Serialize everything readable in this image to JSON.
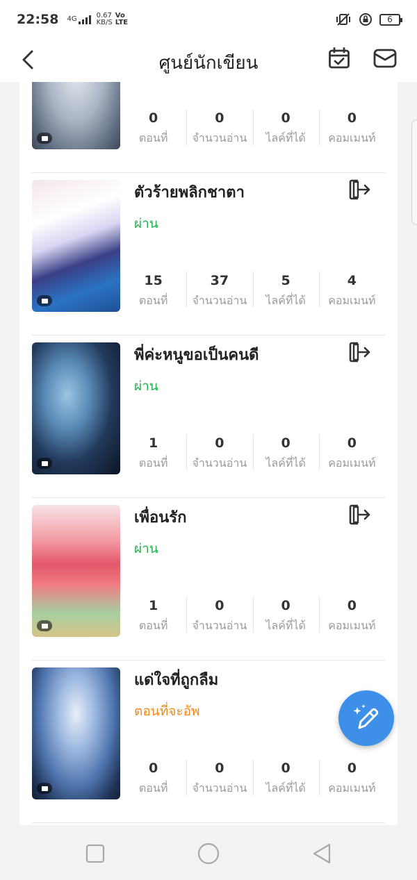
{
  "status_bar": {
    "time": "22:58",
    "network_top": "4G",
    "speed": "0.67",
    "speed_unit": "KB/S",
    "volte": "Vo",
    "lte": "LTE",
    "battery": "6"
  },
  "header": {
    "title": "ศูนย์นักเขียน",
    "back_icon": "chevron-left-icon",
    "calendar_icon": "calendar-check-icon",
    "mail_icon": "mail-icon"
  },
  "stat_labels": {
    "episodes": "ตอนที่",
    "reads": "จำนวนอ่าน",
    "likes": "ไลค์ที่ได้",
    "comments": "คอมเมนท์"
  },
  "books": [
    {
      "title": "",
      "status": "",
      "stats": {
        "episodes": "0",
        "reads": "0",
        "likes": "0",
        "comments": "0"
      }
    },
    {
      "title": "ตัวร้ายพลิกชาตา",
      "status": "ผ่าน",
      "stats": {
        "episodes": "15",
        "reads": "37",
        "likes": "5",
        "comments": "4"
      }
    },
    {
      "title": "พี่ค่ะหนูขอเป็นคนดี",
      "status": "ผ่าน",
      "stats": {
        "episodes": "1",
        "reads": "0",
        "likes": "0",
        "comments": "0"
      }
    },
    {
      "title": "เพื่อนรัก",
      "status": "ผ่าน",
      "stats": {
        "episodes": "1",
        "reads": "0",
        "likes": "0",
        "comments": "0"
      }
    },
    {
      "title": "แด่ใจที่ถูกลืม",
      "status": "ตอนที่จะอัพ",
      "stats": {
        "episodes": "0",
        "reads": "0",
        "likes": "0",
        "comments": "0"
      }
    }
  ],
  "colors": {
    "status_pass": "#22b14c",
    "status_pending": "#f08a1c",
    "fab": "#3d8fe8"
  },
  "fab_icon": "pencil-sparkle-icon",
  "nav": {
    "recents_icon": "square-icon",
    "home_icon": "circle-icon",
    "back_icon": "triangle-back-icon"
  }
}
